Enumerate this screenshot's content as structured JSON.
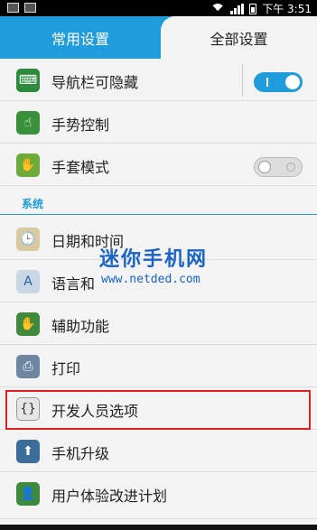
{
  "statusbar": {
    "time": "下午 3:51"
  },
  "tabs": {
    "common": "常用设置",
    "all": "全部设置"
  },
  "items": [
    {
      "label": "导航栏可隐藏",
      "icon": "keyboard-icon",
      "toggle": "on"
    },
    {
      "label": "手势控制",
      "icon": "gesture-icon"
    },
    {
      "label": "手套模式",
      "icon": "glove-icon",
      "toggle": "off"
    }
  ],
  "section": {
    "system": "系统"
  },
  "system_items": [
    {
      "label": "日期和时间",
      "icon": "clock-icon"
    },
    {
      "label": "语言和",
      "icon": "language-icon"
    },
    {
      "label": "辅助功能",
      "icon": "hand-icon"
    },
    {
      "label": "打印",
      "icon": "printer-icon"
    },
    {
      "label": "开发人员选项",
      "icon": "braces-icon"
    },
    {
      "label": "手机升级",
      "icon": "phone-update-icon"
    },
    {
      "label": "用户体验改进计划",
      "icon": "user-experience-icon"
    }
  ],
  "watermark": {
    "title": "迷你手机网",
    "url": "www.netded.com"
  },
  "colors": {
    "accent": "#1e9cdc",
    "highlight": "#e0201e"
  }
}
